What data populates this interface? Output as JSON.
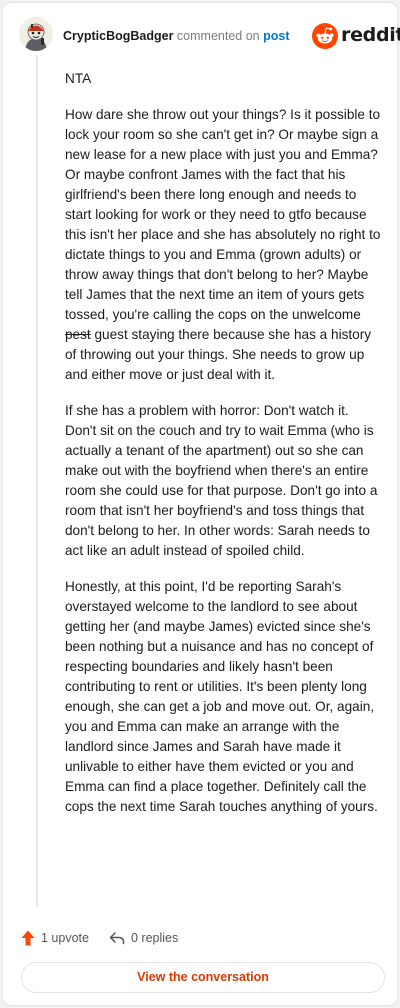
{
  "header": {
    "username": "CrypticBogBadger",
    "action": "commented on",
    "link_text": "post"
  },
  "brand": {
    "wordmark": "reddit",
    "icon": "reddit-logo-icon",
    "color": "#ff4500"
  },
  "comment": {
    "paragraphs": [
      {
        "text": "NTA"
      },
      {
        "before": "How dare she throw out your things? Is it possible to lock your room so she can't get in? Or maybe sign a new lease for a new place with just you and Emma? Or maybe confront James with the fact that his girlfriend's been there long enough and needs to start looking for work or they need to gtfo because this isn't her place and she has absolutely no right to dictate things to you and Emma (grown adults) or throw away things that don't belong to her? Maybe tell James that the next time an item of yours gets tossed, you're calling the cops on the unwelcome",
        "struck": "pest",
        "after": "guest staying there because she has a history of throwing out your things. She needs to grow up and either move or just deal with it."
      },
      {
        "text": "If she has a problem with horror: Don't watch it. Don't sit on the couch and try to wait Emma (who is actually a tenant of the apartment) out so she can make out with the boyfriend when there's an entire room she could use for that purpose. Don't go into a room that isn't her boyfriend's and toss things that don't belong to her. In other words: Sarah needs to act like an adult instead of spoiled child."
      },
      {
        "text": "Honestly, at this point, I'd be reporting Sarah's overstayed welcome to the landlord to see about getting her (and maybe James) evicted since she's been nothing but a nuisance and has no concept of respecting boundaries and likely hasn't been contributing to rent or utilities. It's been plenty long enough, she can get a job and move out. Or, again, you and Emma can make an arrange with the landlord since James and Sarah have made it unlivable to either have them evicted or you and Emma can find a place together. Definitely call the cops the next time Sarah touches anything of yours."
      }
    ]
  },
  "footer": {
    "upvotes": "1 upvote",
    "upvote_icon": "upvote-arrow-icon",
    "upvote_color": "#ff4500",
    "replies": "0 replies",
    "reply_icon": "reply-arrow-icon"
  },
  "cta": {
    "label": "View the conversation",
    "color": "#d93a00"
  }
}
